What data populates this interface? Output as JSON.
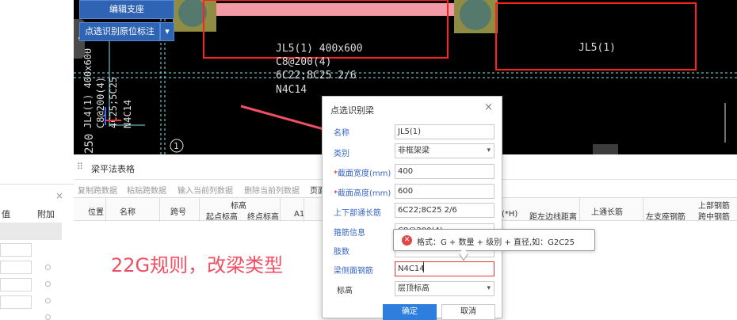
{
  "toolbar_buttons": {
    "edit_support": "编辑支座",
    "point_select": "点选识别原位标注",
    "dropdown_glyph": "▾"
  },
  "cad": {
    "beam_label_1": "JL5(1) 400x600",
    "stirrup": "C8@200(4)",
    "top_bars": "6C22;8C25 2/6",
    "side_bars": "N4C14",
    "beam_label_2": "JL5(1)",
    "left_label_a": "JL4(1) 400x600",
    "left_label_b": "C8@200(4)",
    "left_label_c": "4C25;5C25",
    "left_label_d": "N4C14",
    "dim_250": "250",
    "axis_1": "1",
    "colors": {
      "canvas": "#000000",
      "beam_pink": "#f29aa6",
      "column_olive": "#8f8d44",
      "frame_red": "#ff2020",
      "line_cyan": "#7fe3ec"
    }
  },
  "left_panel": {
    "close_glyph": "×",
    "col_value": "值",
    "col_extra": "附加"
  },
  "table_panel": {
    "title": "梁平法表格",
    "actions": [
      "复制跨数据",
      "粘贴跨数据",
      "输入当前列数据",
      "删除当前列数据",
      "页面"
    ],
    "headers": {
      "position": "位置",
      "name": "名称",
      "span": "跨号",
      "elevation": "标高",
      "start_elev": "起点标高",
      "end_elev": "终点标高",
      "a1": "A1",
      "bxh": "(*H)",
      "left_edge": "距左边线距离",
      "top_through": "上通长筋",
      "top_rebar": "上部钢筋",
      "left_support": "左支座钢筋",
      "mid_span": "跨中钢筋"
    }
  },
  "annotation": "22G规则，改梁类型",
  "dialog": {
    "title": "点选识别梁",
    "close_glyph": "×",
    "fields": [
      {
        "label": "名称",
        "value": "JL5(1)"
      },
      {
        "label": "类别",
        "value": "非框架梁"
      },
      {
        "label": "截面宽度(mm)",
        "value": "400",
        "required": "*"
      },
      {
        "label": "截面高度(mm)",
        "value": "600",
        "required": "*"
      },
      {
        "label": "上下部通长筋",
        "value": "6C22;8C25 2/6"
      },
      {
        "label": "箍筋信息",
        "value": "C8@200(4)"
      },
      {
        "label": "肢数",
        "value": ""
      },
      {
        "label": "梁侧面钢筋",
        "value": "N4C14"
      },
      {
        "label": "标高",
        "value": "层顶标高"
      }
    ],
    "ok": "确定",
    "cancel": "取消"
  },
  "tooltip": {
    "icon": "✕",
    "text": "格式：G + 数量 + 级别 + 直径,如：G2C25"
  }
}
